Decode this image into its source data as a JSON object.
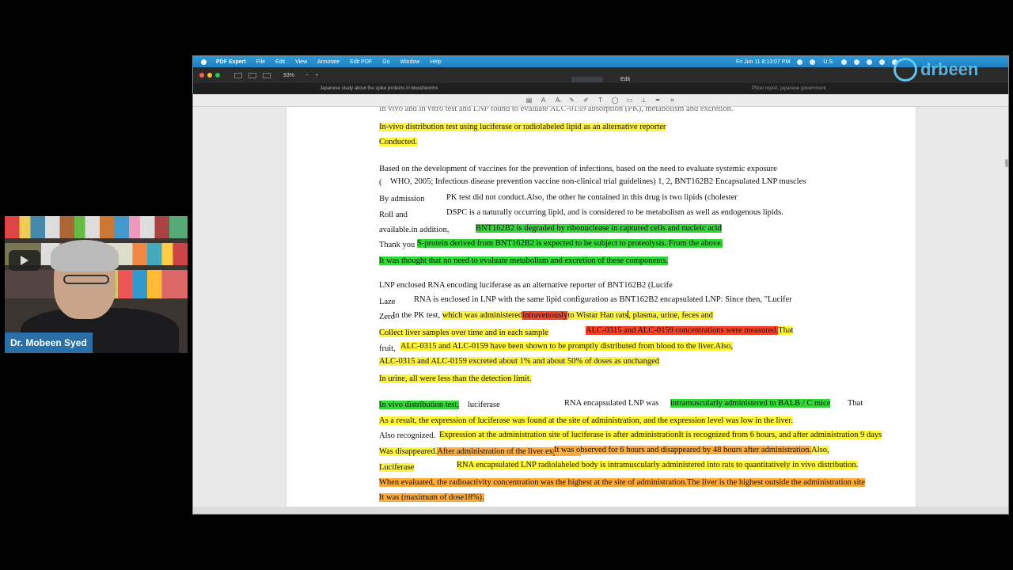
{
  "webcam": {
    "name": "Dr. Mobeen Syed"
  },
  "menubar": {
    "app": "PDF Expert",
    "items": [
      "File",
      "Edit",
      "View",
      "Annotate",
      "Edit PDF",
      "Go",
      "Window",
      "Help"
    ],
    "clock": "Fri Jun 11 8:13:07 PM",
    "lang": "U.S."
  },
  "watermark": "drbeen",
  "toolbar": {
    "zoom": "93%",
    "mode": "Edit"
  },
  "tabs": {
    "active": "Japanese study about the spike proteins in blood/worms",
    "right": "Pfizer report, japanese government"
  },
  "doc": {
    "l0": "In vivo and in vitro test and LNP found to evaluate ALC-0159 absorption (PK), metabolism and excretion.",
    "l1": "In-vivo distribution test using luciferase or radiolabeled lipid as an alternative reporter",
    "l2": "Conducted.",
    "l3": "Based on the development of vaccines for the prevention of infections, based on the need to evaluate systemic exposure",
    "l4a": "(",
    "l4b": "WHO, 2005; Infectious disease prevention vaccine non-clinical trial guidelines) 1, 2, BNT162B2 Encapsulated LNP muscles",
    "l5a": "By admission",
    "l5b": "PK test did not conduct.Also, the other he contained in this drug is two lipids (cholester",
    "l6a": "Roll and",
    "l6b": "DSPC is a naturally occurring lipid, and is considered to be metabolism as well as endogenous lipids.",
    "l7a": "available.in addition,",
    "l7b": "BNT162B2 is degraded by ribonuclease in captured cells and nucleic acid",
    "l8a": "Thank you",
    "l8b": "S-protein derived from BNT162B2 is expected to be subject to proteolysis. From the above.",
    "l9": "It was thought that no need to evaluate metabolism and excretion of these components.",
    "l10": "LNP enclosed RNA encoding luciferase as an alternative reporter of BNT162B2 (Lucife",
    "l11a": "Laze",
    "l11b": "RNA is enclosed in LNP with the same lipid configuration as BNT162B2 encapsulated LNP: Since then, \"Lucifer",
    "l12a": "Zero",
    "l12b": "In the PK test,",
    "l12c": "which was administered",
    "l12d": "intravenously",
    "l12e": "to Wistar Han rats",
    "l12f": ", plasma, urine, feces and",
    "l13a": "Collect liver samples over time and in each sample",
    "l13b": "ALC-0315 and ALC-0159 concentrations were measured.",
    "l13c": "That",
    "l14a": "fruit,",
    "l14b": "ALC-0315 and ALC-0159 have been shown to be promptly distributed from blood to the liver.Also,",
    "l15": "ALC-0315 and ALC-0159 excreted about 1% and about 50% of doses as unchanged",
    "l16": "In urine, all were less than the detection limit.",
    "l17a": "In vivo distribution test,",
    "l17b": "luciferase",
    "l17c": "RNA encapsulated LNP was",
    "l17d": "intramuscularly administered to BALB / C mice",
    "l17e": "That",
    "l18": "As a result, the expression of luciferase was found at the site of administration, and the expression level was low in the liver.",
    "l19a": "Also recognized.",
    "l19b": "Expression at the administration site of luciferase is after administration",
    "l19c": "It is recognized from 6 hours, and after administration 9 days",
    "l20a": "Was disappeared.",
    "l20b": "After administration of the liver expression",
    "l20c": "It was observed for 6 hours and disappeared by 48 hours after administration.",
    "l20d": "Also,",
    "l21a": "Luciferase",
    "l21b": "RNA encapsulated LNP radiolabeled body is intramuscularly administered into rats to quantitatively in vivo distribution.",
    "l22": "When evaluated, the radioactivity concentration was the highest at the site of administration.The liver is the highest outside the administration site",
    "l23a": "It was (maximum of dose",
    "l23b": "18%)."
  }
}
